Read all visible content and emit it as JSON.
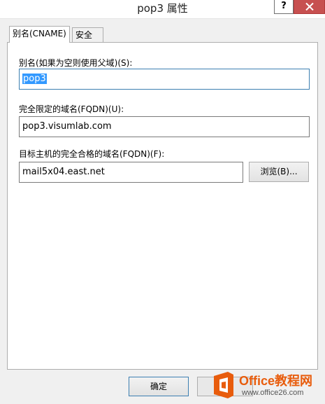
{
  "window": {
    "title": "pop3 属性",
    "help_label": "?"
  },
  "tabs": [
    {
      "label": "别名(CNAME)",
      "active": true
    },
    {
      "label": "安全",
      "active": false
    }
  ],
  "form": {
    "alias_label": "别名(如果为空则使用父域)(S):",
    "alias_value": "pop3",
    "fqdn_label": "完全限定的域名(FQDN)(U):",
    "fqdn_value": "pop3.visumlab.com",
    "target_label": "目标主机的完全合格的域名(FQDN)(F):",
    "target_value": "mail5x04.east.net",
    "browse_label": "浏览(B)..."
  },
  "footer": {
    "ok_label": "确定"
  },
  "watermark": {
    "brand": "Office教程网",
    "url": "www.office26.com"
  },
  "colors": {
    "close": "#c75050",
    "selection": "#3399ff",
    "watermark": "#e85c0c"
  }
}
